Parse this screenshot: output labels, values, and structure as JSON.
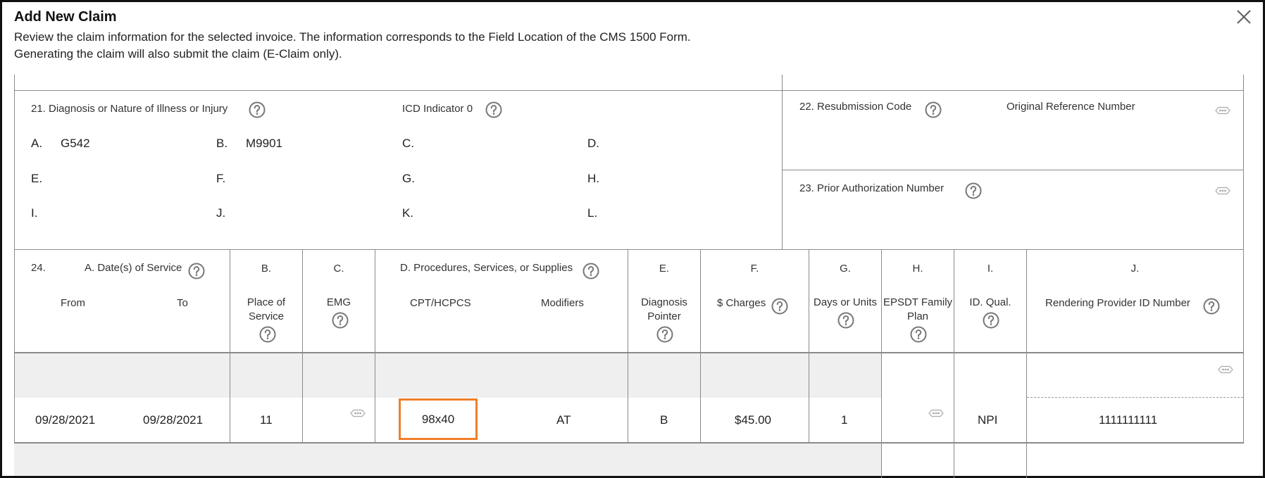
{
  "dialog": {
    "title": "Add New Claim",
    "desc_line1": "Review the claim information for the selected invoice. The information corresponds to the Field Location of the CMS 1500 Form.",
    "desc_line2": "Generating the claim will also submit the claim (E-Claim only)."
  },
  "box21": {
    "label": "21. Diagnosis or Nature of Illness or Injury",
    "icd_label": "ICD Indicator 0",
    "codes": [
      {
        "letter": "A.",
        "value": "G542"
      },
      {
        "letter": "B.",
        "value": "M9901"
      },
      {
        "letter": "C.",
        "value": ""
      },
      {
        "letter": "D.",
        "value": ""
      },
      {
        "letter": "E.",
        "value": ""
      },
      {
        "letter": "F.",
        "value": ""
      },
      {
        "letter": "G.",
        "value": ""
      },
      {
        "letter": "H.",
        "value": ""
      },
      {
        "letter": "I.",
        "value": ""
      },
      {
        "letter": "J.",
        "value": ""
      },
      {
        "letter": "K.",
        "value": ""
      },
      {
        "letter": "L.",
        "value": ""
      }
    ]
  },
  "box22": {
    "label": "22. Resubmission Code",
    "orig_ref_label": "Original Reference Number"
  },
  "box23": {
    "label": "23. Prior Authorization Number"
  },
  "box24": {
    "num": "24.",
    "col_a": "A. Date(s) of Service",
    "from": "From",
    "to": "To",
    "col_b": "B.",
    "col_b_sub": "Place of Service",
    "col_c": "C.",
    "col_c_sub": "EMG",
    "col_d": "D. Procedures, Services, or Supplies",
    "cpt": "CPT/HCPCS",
    "modifiers": "Modifiers",
    "col_e": "E.",
    "col_e_sub": "Diagnosis Pointer",
    "col_f": "F.",
    "col_f_sub": "$ Charges",
    "col_g": "G.",
    "col_g_sub": "Days or Units",
    "col_h": "H.",
    "col_h_sub": "EPSDT Family Plan",
    "col_i": "I.",
    "col_i_sub": "ID. Qual.",
    "col_j": "J.",
    "col_j_sub": "Rendering Provider ID Number"
  },
  "line1": {
    "from": "09/28/2021",
    "to": "09/28/2021",
    "pos": "11",
    "emg": "",
    "cpt": "98x40",
    "modifiers": "AT",
    "pointer": "B",
    "charges": "$45.00",
    "units": "1",
    "epsdt": "",
    "id_qual": "NPI",
    "provider_id": "1111111111"
  },
  "colors": {
    "highlight": "#f07f2a",
    "shade": "#efefef",
    "rule": "#8a8a8a"
  }
}
